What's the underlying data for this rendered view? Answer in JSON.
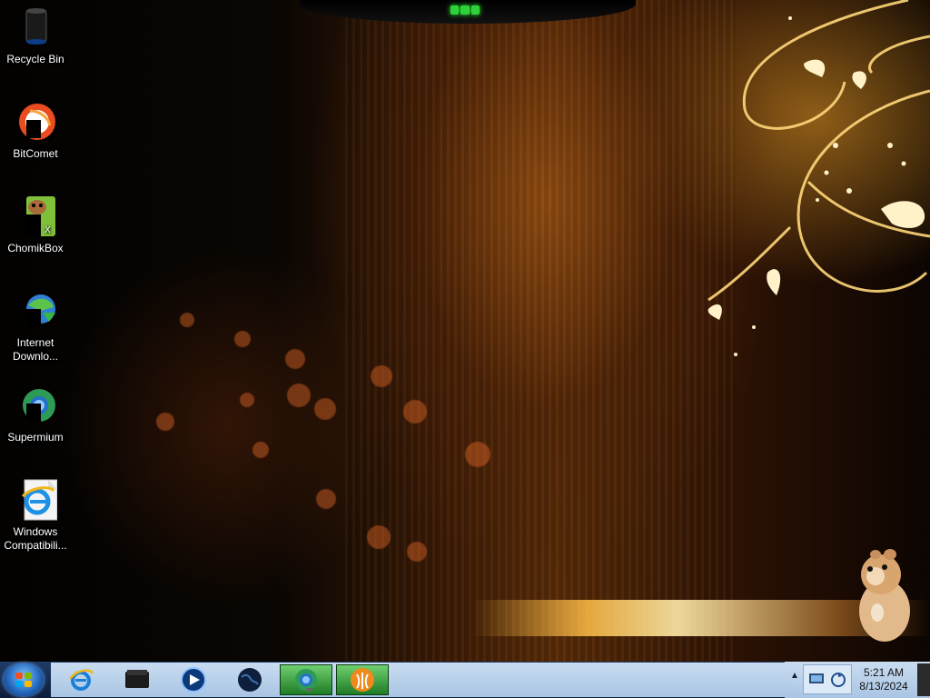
{
  "desktop": {
    "icons": [
      {
        "label": "Recycle Bin",
        "icon": "recycle-bin-icon"
      },
      {
        "label": "BitComet",
        "icon": "bitcomet-icon"
      },
      {
        "label": "ChomikBox",
        "icon": "chomikbox-icon"
      },
      {
        "label": "Internet Downlo...",
        "icon": "internet-download-manager-icon"
      },
      {
        "label": "Supermium",
        "icon": "supermium-icon"
      },
      {
        "label": "Windows Compatibili...",
        "icon": "windows-compatibility-icon"
      }
    ]
  },
  "taskbar": {
    "start": {
      "icon": "windows-start-icon"
    },
    "pinned": [
      {
        "name": "Internet Explorer",
        "icon": "internet-explorer-icon",
        "active": false
      },
      {
        "name": "Folder",
        "icon": "black-folder-icon",
        "active": false
      },
      {
        "name": "Windows Media Player",
        "icon": "media-player-icon",
        "active": false
      },
      {
        "name": "Globe",
        "icon": "globe-icon",
        "active": false
      },
      {
        "name": "Supermium",
        "icon": "supermium-icon",
        "active": true
      },
      {
        "name": "BitComet",
        "icon": "bitcomet-icon",
        "active": true
      }
    ],
    "tray": {
      "icons": [
        "network-icon",
        "sync-icon"
      ],
      "time": "5:21 AM",
      "date": "8/13/2024"
    }
  },
  "colors": {
    "taskbar_bg": "#a9c5e4",
    "wallpaper_accent": "#f2b640"
  }
}
